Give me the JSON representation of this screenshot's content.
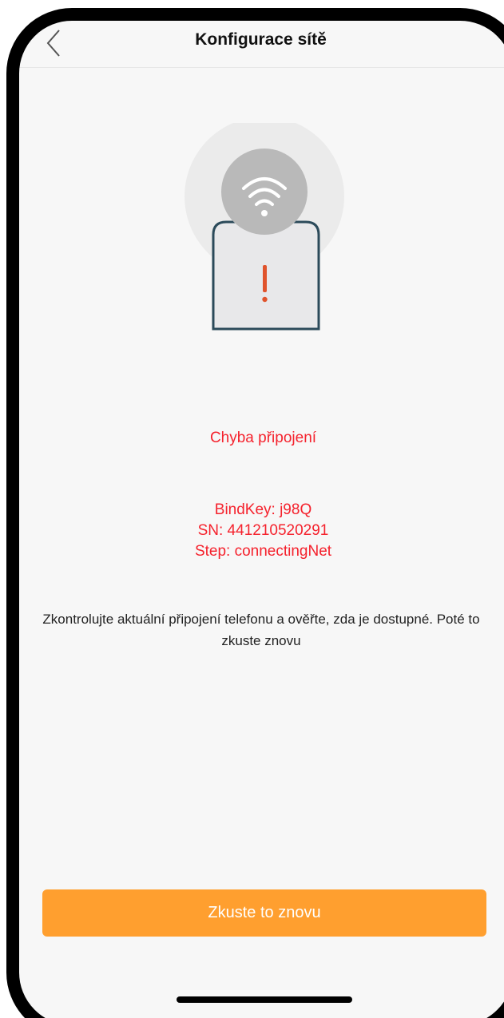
{
  "header": {
    "title": "Konfigurace sítě",
    "back_icon": "chevron-left-icon"
  },
  "illustration": {
    "wifi_icon": "wifi-icon",
    "alert_icon": "exclamation-icon",
    "phone": "phone-outline",
    "colors": {
      "halo": "#ebebeb",
      "wifi_circle": "#b9b9b9",
      "phone_outline": "#2b4a5a",
      "phone_fill": "#e8e8ea",
      "alert": "#e0532c"
    }
  },
  "error": {
    "title": "Chyba připojení",
    "bind_key": "BindKey: j98Q",
    "sn": "SN: 441210520291",
    "step": "Step: connectingNet"
  },
  "hint": "Zkontrolujte aktuální připojení telefonu a ověřte, zda je dostupné. Poté to zkuste znovu",
  "actions": {
    "retry_label": "Zkuste to znovu"
  },
  "colors": {
    "error_text": "#f5222d",
    "primary_button": "#ff9f2f",
    "background": "#f7f7f7"
  }
}
